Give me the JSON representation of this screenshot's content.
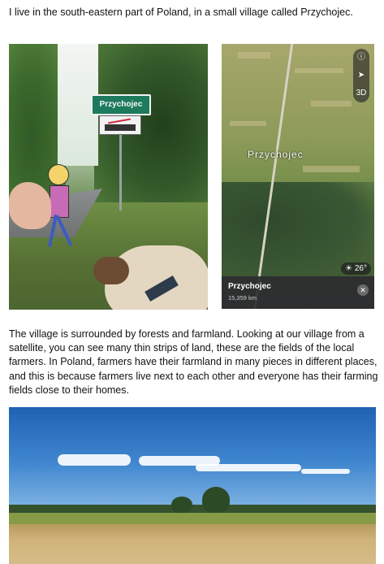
{
  "intro_text": "I live in the south-eastern part of Poland, in a small village called Przychojec.",
  "left_photo": {
    "sign_text": "Przychojec"
  },
  "map": {
    "place_label": "Przychojec",
    "controls": [
      "ⓘ",
      "➤",
      "3D"
    ],
    "temperature": "☀ 26°",
    "info_title": "Przychojec",
    "info_distance": "15,359 km",
    "close_icon": "close-icon"
  },
  "paragraph": "The village is surrounded by forests and farmland. Looking at our village from a satellite, you can see many thin strips of land, these are the fields of the local farmers. In Poland, farmers have their farmland in many pieces in different places, and this is because farmers live next to each other and everyone has their farming fields close to their homes."
}
